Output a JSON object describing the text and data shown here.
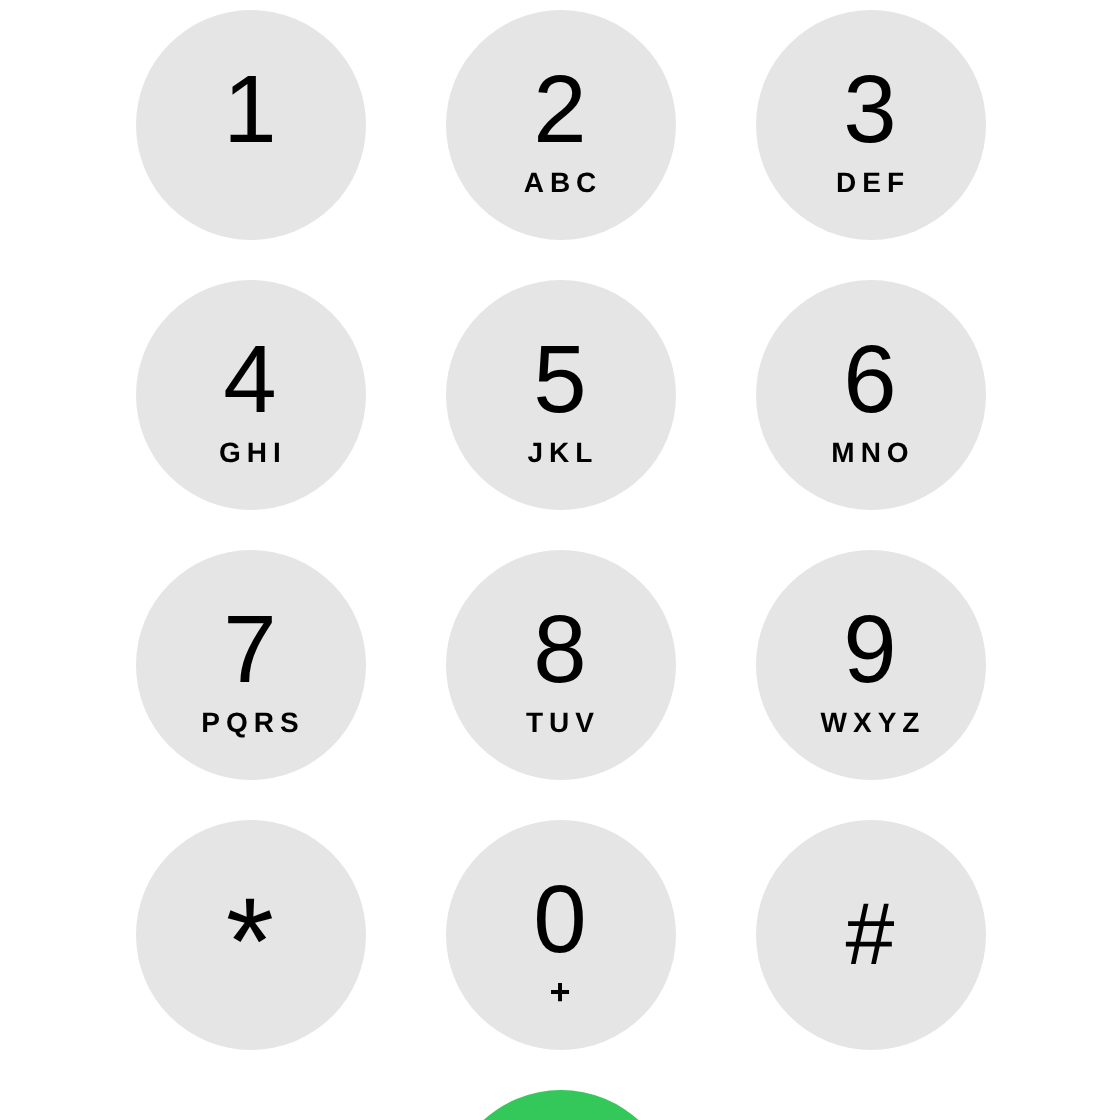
{
  "keys": [
    {
      "digit": "1"
    },
    {
      "digit": "2",
      "letters": "ABC"
    },
    {
      "digit": "3",
      "letters": "DEF"
    },
    {
      "digit": "4",
      "letters": "GHI"
    },
    {
      "digit": "5",
      "letters": "JKL"
    },
    {
      "digit": "6",
      "letters": "MNO"
    },
    {
      "digit": "7",
      "letters": "PQRS"
    },
    {
      "digit": "8",
      "letters": "TUV"
    },
    {
      "digit": "9",
      "letters": "WXYZ"
    },
    {
      "digit": "*"
    },
    {
      "digit": "0",
      "letters": "+"
    },
    {
      "digit": "#"
    }
  ]
}
